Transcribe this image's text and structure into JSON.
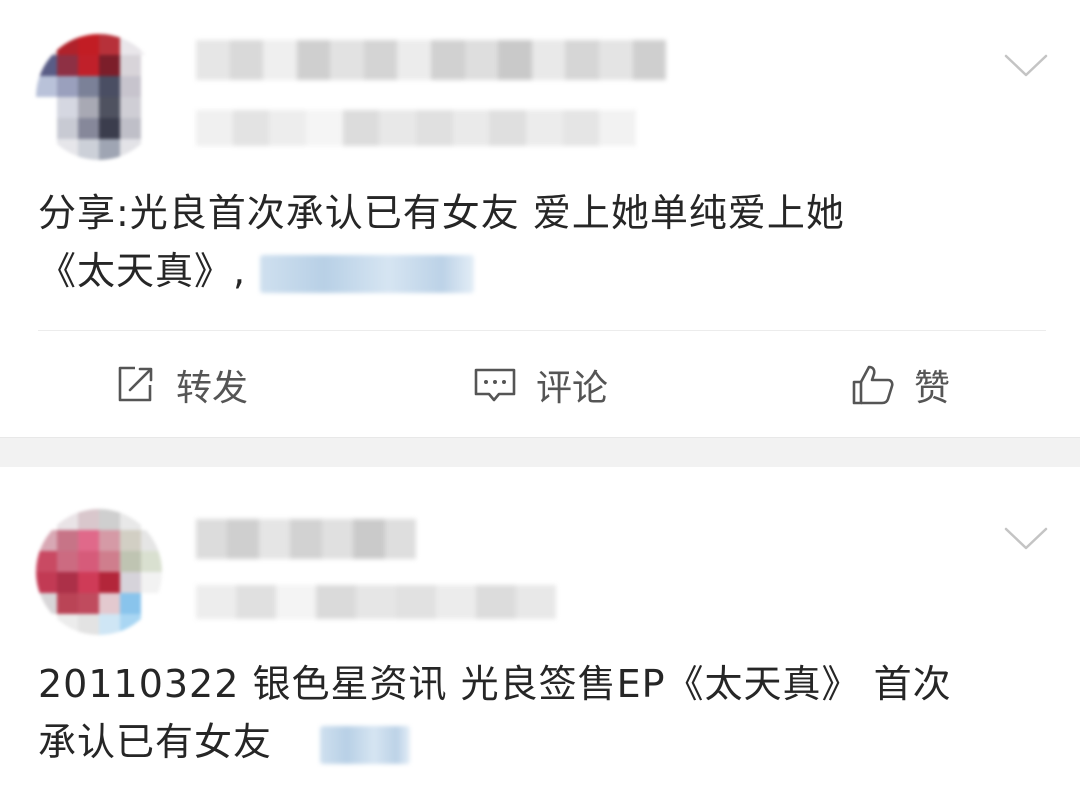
{
  "posts": [
    {
      "text_line1": "分享:光良首次承认已有女友 爱上她单纯爱上她",
      "text_line2": "《太天真》,",
      "actions": {
        "repost_label": "转发",
        "comment_label": "评论",
        "like_label": "赞"
      },
      "icons": [
        "repost-icon",
        "comment-icon",
        "like-icon",
        "chevron-down-icon"
      ]
    },
    {
      "text_line1": "20110322 银色星资讯 光良签售EP《太天真》 首次",
      "text_line2": "承认已有女友",
      "icons": [
        "chevron-down-icon"
      ]
    }
  ],
  "colors": {
    "separator": "#f2f2f2",
    "text": "#262626",
    "action_text": "#555555",
    "link_blur": "#bcd2e7"
  }
}
